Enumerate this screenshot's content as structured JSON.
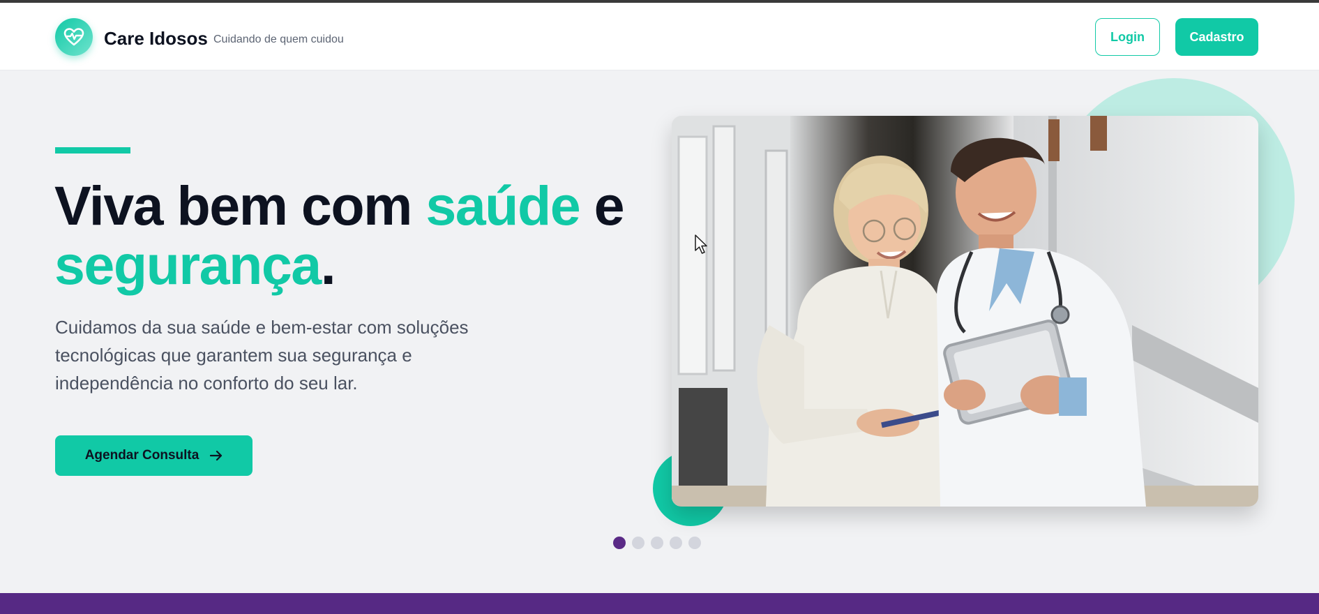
{
  "header": {
    "brand": "Care Idosos",
    "tagline": "Cuidando de quem cuidou",
    "login_label": "Login",
    "signup_label": "Cadastro",
    "logo_icon": "heart-pulse-icon"
  },
  "hero": {
    "title_part1": "Viva bem com ",
    "title_highlight1": "saúde",
    "title_part2": " e ",
    "title_highlight2": "segurança",
    "title_end": ".",
    "description": "Cuidamos da sua saúde e bem-estar com soluções tecnológicas que garantem sua segurança e independência no conforto do seu lar.",
    "cta_label": "Agendar Consulta",
    "cta_icon": "arrow-right-icon",
    "image_icon": "doctor-elderly-photo"
  },
  "carousel": {
    "total": 5,
    "active_index": 0
  },
  "colors": {
    "primary": "#11c9a6",
    "dark": "#0d1220",
    "purple": "#562984",
    "background": "#f1f2f4"
  }
}
